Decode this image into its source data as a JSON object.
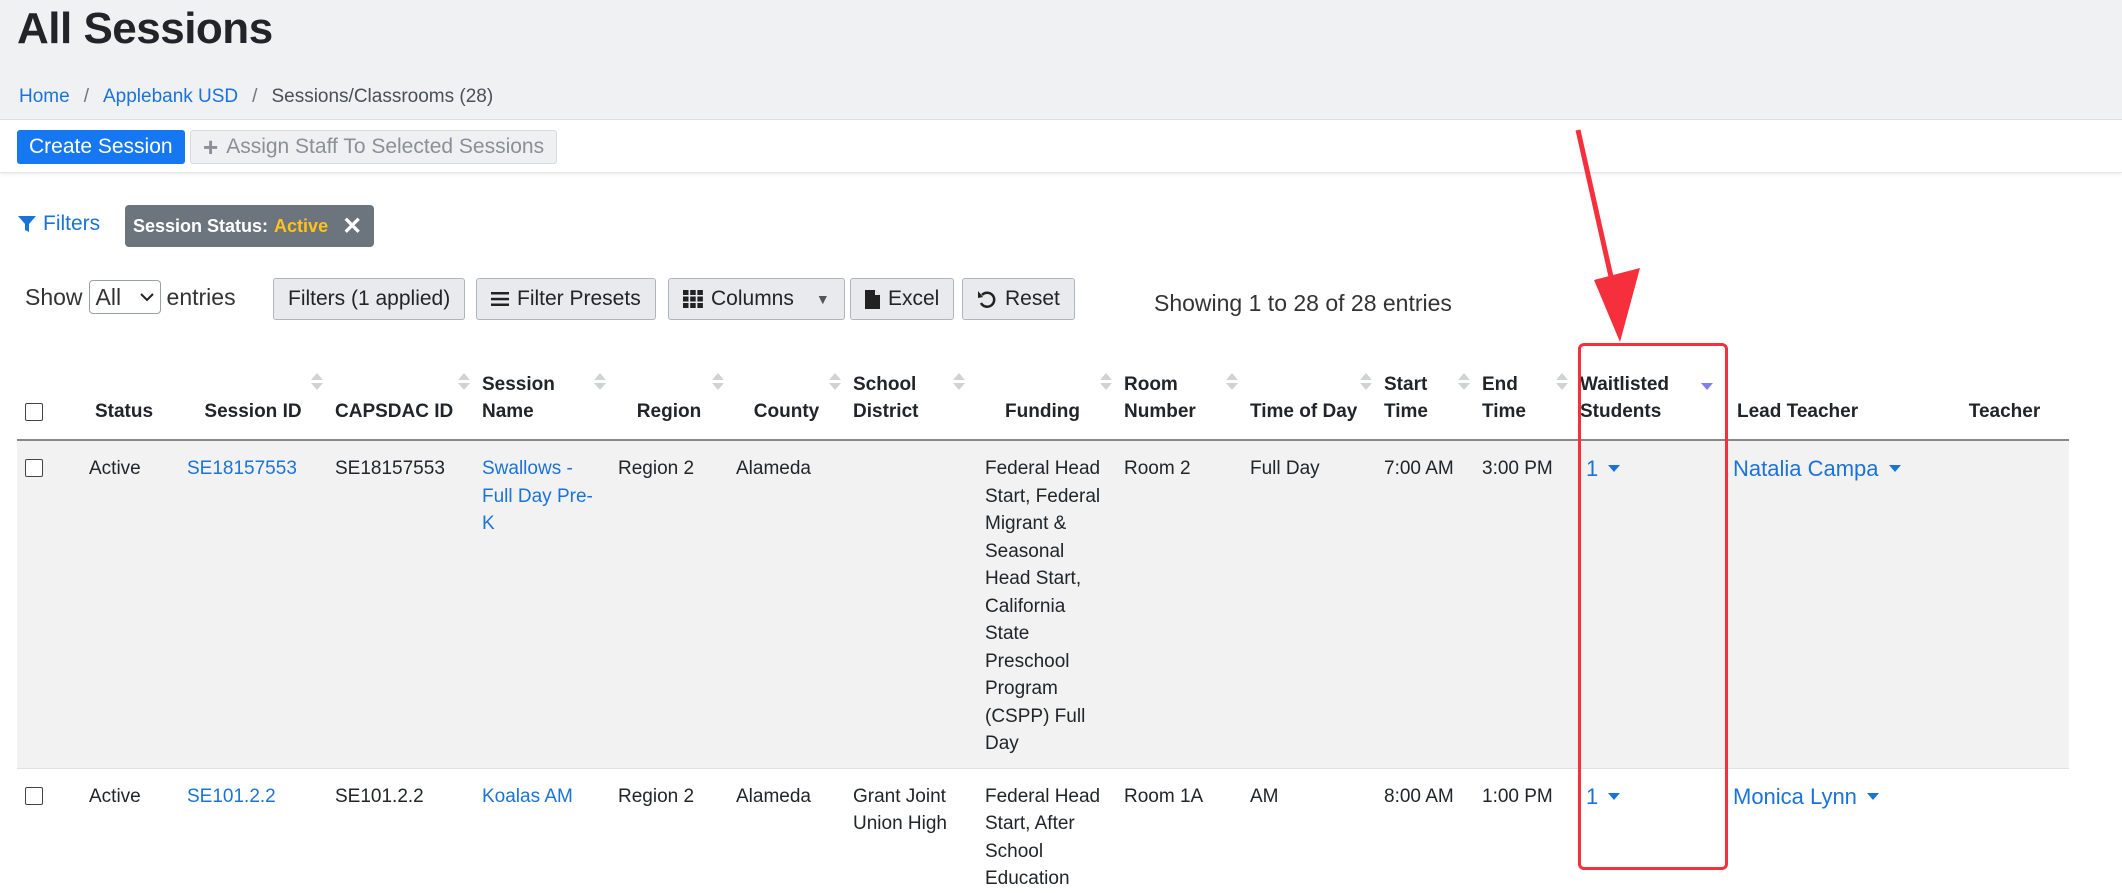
{
  "page_title": "All Sessions",
  "breadcrumb": {
    "home": "Home",
    "org": "Applebank USD",
    "current": "Sessions/Classrooms (28)"
  },
  "toolbar": {
    "create_label": "Create Session",
    "assign_label": "Assign Staff To Selected Sessions"
  },
  "filters": {
    "link_label": "Filters",
    "chip_key": "Session Status:",
    "chip_value": "Active"
  },
  "controls": {
    "show_label": "Show",
    "entries_label": "entries",
    "page_size": "All",
    "filters_applied": "Filters (1 applied)",
    "filter_presets": "Filter Presets",
    "columns": "Columns",
    "excel": "Excel",
    "reset": "Reset",
    "showing_text": "Showing 1 to 28 of 28 entries"
  },
  "table": {
    "headers": [
      "Status",
      "Session ID",
      "CAPSDAC ID",
      "Session Name",
      "Region",
      "County",
      "School District",
      "Funding",
      "Room Number",
      "Time of Day",
      "Start Time",
      "End Time",
      "Waitlisted Students",
      "Lead Teacher",
      "Teacher"
    ],
    "rows": [
      {
        "status": "Active",
        "session_id": "SE18157553",
        "capsdac_id": "SE18157553",
        "session_name": "Swallows - Full Day Pre-K",
        "region": "Region 2",
        "county": "Alameda",
        "district": "",
        "funding": "Federal Head Start, Federal Migrant & Seasonal Head Start, California State Preschool Program (CSPP) Full Day",
        "room": "Room 2",
        "time_of_day": "Full Day",
        "start": "7:00 AM",
        "end": "3:00 PM",
        "waitlisted": "1",
        "lead_teacher": "Natalia Campa",
        "teacher": ""
      },
      {
        "status": "Active",
        "session_id": "SE101.2.2",
        "capsdac_id": "SE101.2.2",
        "session_name": "Koalas AM",
        "region": "Region 2",
        "county": "Alameda",
        "district": "Grant Joint Union High",
        "funding": "Federal Head Start, After School Education",
        "room": "Room 1A",
        "time_of_day": "AM",
        "start": "8:00 AM",
        "end": "1:00 PM",
        "waitlisted": "1",
        "lead_teacher": "Monica Lynn",
        "teacher": ""
      }
    ]
  },
  "colors": {
    "accent": "#1677f2",
    "link": "#1a73d9",
    "chip_bg": "#6c757d",
    "chip_value": "#ffc21a",
    "highlight": "#f5303c"
  }
}
